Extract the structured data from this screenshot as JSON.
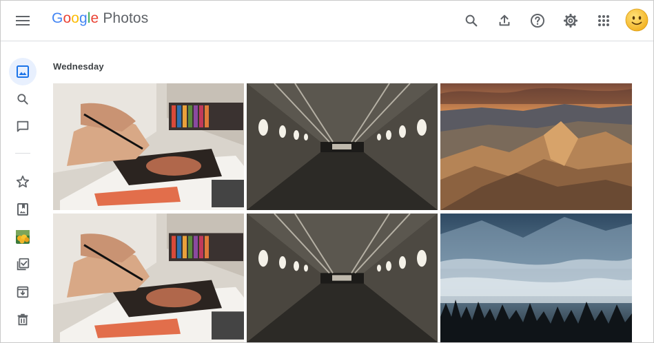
{
  "app": {
    "logo_letters": [
      {
        "ch": "G",
        "color": "#4285f4"
      },
      {
        "ch": "o",
        "color": "#ea4335"
      },
      {
        "ch": "o",
        "color": "#fbbc05"
      },
      {
        "ch": "g",
        "color": "#4285f4"
      },
      {
        "ch": "l",
        "color": "#34a853"
      },
      {
        "ch": "e",
        "color": "#ea4335"
      }
    ],
    "product_name": "Photos"
  },
  "header": {
    "icons": [
      "search-icon",
      "upload-icon",
      "help-icon",
      "settings-icon",
      "apps-grid-icon"
    ],
    "avatar": "smiley-avatar"
  },
  "sidebar": {
    "items": [
      {
        "name": "photos",
        "icon": "image-icon",
        "active": true
      },
      {
        "name": "search",
        "icon": "search-icon"
      },
      {
        "name": "sharing",
        "icon": "chat-icon"
      },
      {
        "name": "favorites",
        "icon": "star-icon"
      },
      {
        "name": "albums",
        "icon": "album-icon"
      },
      {
        "name": "places",
        "icon": "thumbnail-image"
      },
      {
        "name": "utilities",
        "icon": "checklist-icon"
      },
      {
        "name": "archive",
        "icon": "archive-icon"
      },
      {
        "name": "trash",
        "icon": "trash-icon"
      }
    ]
  },
  "main": {
    "date_heading": "Wednesday",
    "photos": [
      {
        "subject": "person drawing with pastels"
      },
      {
        "subject": "lit tunnel corridor"
      },
      {
        "subject": "desert badlands at sunset"
      },
      {
        "subject": "person drawing with pastels"
      },
      {
        "subject": "lit tunnel corridor"
      },
      {
        "subject": "misty pine forest mountains"
      }
    ]
  },
  "colors": {
    "accent": "#1a73e8",
    "active_bg": "#e8f0fe",
    "icon": "#5f6368"
  }
}
